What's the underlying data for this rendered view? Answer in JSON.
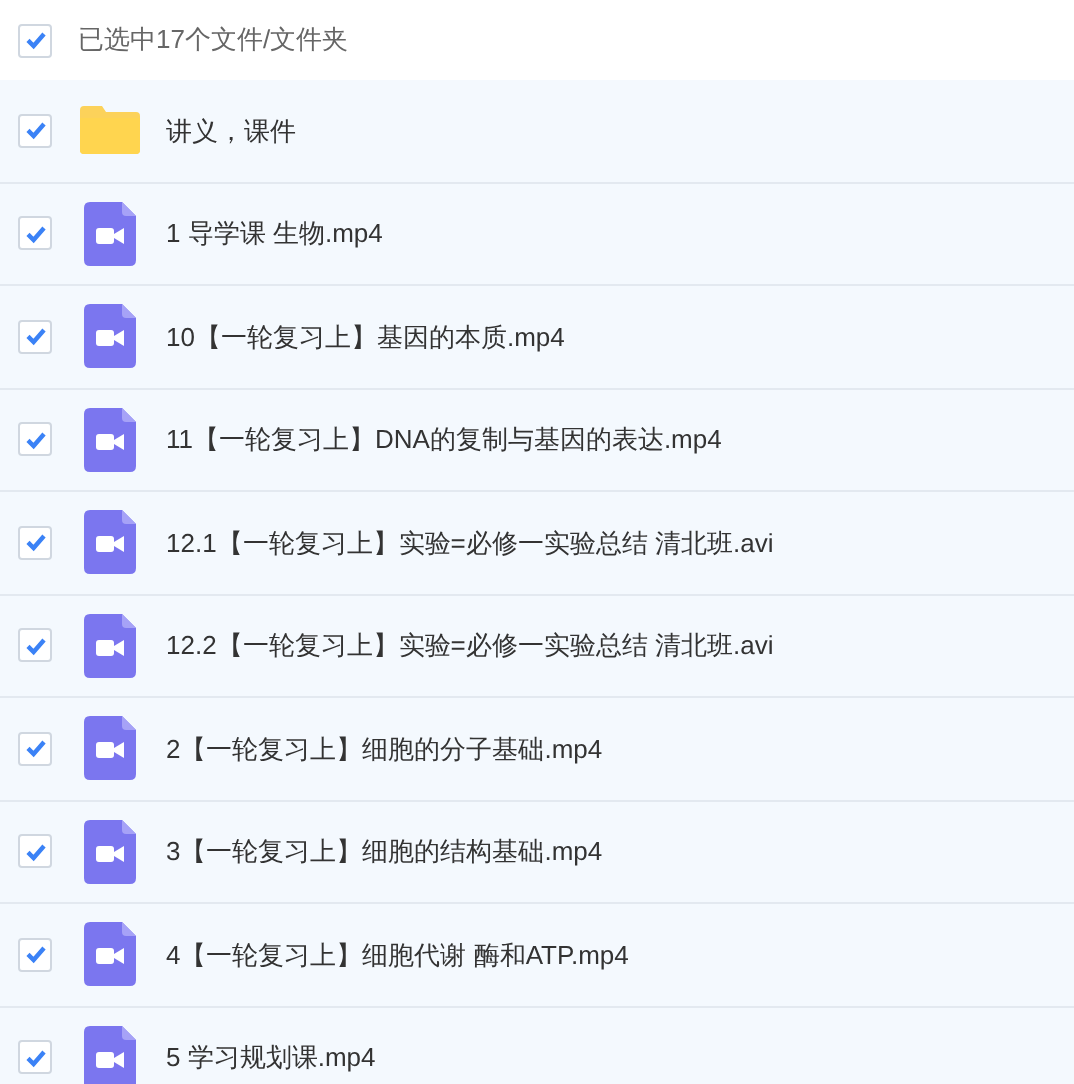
{
  "header": {
    "checked": true,
    "label": "已选中17个文件/文件夹"
  },
  "files": [
    {
      "kind": "folder",
      "name": "讲义，课件",
      "checked": true
    },
    {
      "kind": "video",
      "name": "1 导学课 生物.mp4",
      "checked": true
    },
    {
      "kind": "video",
      "name": "10【一轮复习上】基因的本质.mp4",
      "checked": true
    },
    {
      "kind": "video",
      "name": "11【一轮复习上】DNA的复制与基因的表达.mp4",
      "checked": true
    },
    {
      "kind": "video",
      "name": "12.1【一轮复习上】实验=必修一实验总结 清北班.avi",
      "checked": true
    },
    {
      "kind": "video",
      "name": "12.2【一轮复习上】实验=必修一实验总结 清北班.avi",
      "checked": true
    },
    {
      "kind": "video",
      "name": "2【一轮复习上】细胞的分子基础.mp4",
      "checked": true
    },
    {
      "kind": "video",
      "name": "3【一轮复习上】细胞的结构基础.mp4",
      "checked": true
    },
    {
      "kind": "video",
      "name": "4【一轮复习上】细胞代谢 酶和ATP.mp4",
      "checked": true
    },
    {
      "kind": "video",
      "name": "5 学习规划课.mp4",
      "checked": true
    }
  ]
}
